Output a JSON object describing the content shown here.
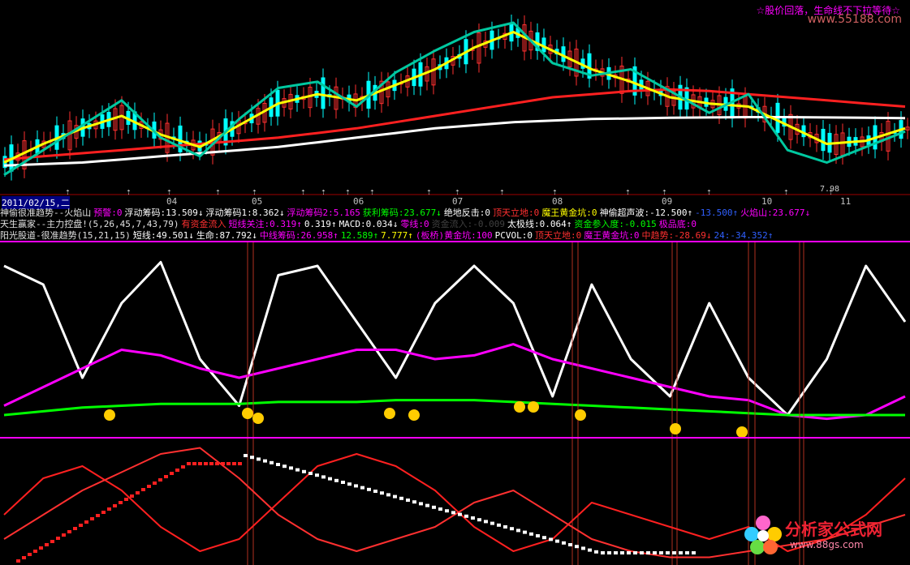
{
  "header": {
    "badge": "☆股价回落，生命线不下拉等待☆",
    "watermark": "www.55188.com"
  },
  "dates": [
    {
      "label": "2011/02/15,二",
      "slot": 0
    },
    {
      "label": "04",
      "slot": 1
    },
    {
      "label": "05",
      "slot": 2
    },
    {
      "label": "06",
      "slot": 3
    },
    {
      "label": "07",
      "slot": 4
    },
    {
      "label": "08",
      "slot": 5
    },
    {
      "label": "09",
      "slot": 6
    },
    {
      "label": "10",
      "slot": 7
    },
    {
      "label": "11",
      "slot": 8
    }
  ],
  "price_note": "7.98",
  "info_rows": [
    {
      "items": [
        {
          "text": "神偷很准趋势--火焰山",
          "color": "#e0e0e0"
        },
        {
          "text": "预警:0",
          "color": "#ff00ff"
        },
        {
          "text": "浮动筹码:13.509↓",
          "color": "#ffffff"
        },
        {
          "text": "浮动筹码1:8.362↓",
          "color": "#ffffff"
        },
        {
          "text": "浮动筹码2:5.165",
          "color": "#ff00ff"
        },
        {
          "text": "获利筹码:23.677↓",
          "color": "#00ff00"
        },
        {
          "text": "绝地反击:0",
          "color": "#ffffff"
        },
        {
          "text": "顶天立地:0",
          "color": "#ff3030"
        },
        {
          "text": "魔王黄金坑:0",
          "color": "#ffff00"
        },
        {
          "text": "神偷超声波:-12.500↑",
          "color": "#ffffff"
        },
        {
          "text": "-13.500↑",
          "color": "#3060ff"
        },
        {
          "text": "火焰山:23.677↓",
          "color": "#ff00ff"
        }
      ]
    },
    {
      "items": [
        {
          "text": "天生赢家--主力控盘!(5,26,45,7,43,79)",
          "color": "#e0e0e0"
        },
        {
          "text": "有资金流入",
          "color": "#ff3030"
        },
        {
          "text": "短线关注:0.319↑",
          "color": "#ff00ff"
        },
        {
          "text": "0.319↑",
          "color": "#ffffff"
        },
        {
          "text": "MACD:0.034↓",
          "color": "#ffffff"
        },
        {
          "text": "零线:0",
          "color": "#ff00ff"
        },
        {
          "text": "资金流入:-0.009",
          "color": "#404040"
        },
        {
          "text": "太极线:0.064↑",
          "color": "#ffffff"
        },
        {
          "text": "资金参入度:-0.015",
          "color": "#00ff00"
        },
        {
          "text": "极品底:0",
          "color": "#ff00ff"
        }
      ]
    },
    {
      "items": [
        {
          "text": "阳光股道-很准趋势(15,21,15)",
          "color": "#e0e0e0"
        },
        {
          "text": "短线:49.501↓",
          "color": "#ffffff"
        },
        {
          "text": "生命:87.792↓",
          "color": "#ffffff"
        },
        {
          "text": "中线筹码:26.958↑",
          "color": "#ff00ff"
        },
        {
          "text": "12.589↑",
          "color": "#00ff00"
        },
        {
          "text": "7.777↑",
          "color": "#ffff00"
        },
        {
          "text": "(板桥)黄金坑:100",
          "color": "#ff00ff"
        },
        {
          "text": "PCVOL:0",
          "color": "#ffffff"
        },
        {
          "text": "顶天立地:0",
          "color": "#ff3030"
        },
        {
          "text": "魔王黄金坑:0",
          "color": "#ff00ff"
        },
        {
          "text": "中趋势:-28.69↓",
          "color": "#ff3030"
        },
        {
          "text": "24:-34.352↑",
          "color": "#3060ff"
        }
      ]
    }
  ],
  "logo": {
    "title": "分析家公式网",
    "url": "www.88gs.com"
  },
  "colors": {
    "up": "#ff3030",
    "down": "#00ffff",
    "ma_red": "#ff2020",
    "ma_white": "#ffffff",
    "yellow": "#ffff00",
    "magenta": "#ff00ff",
    "cyan_green": "#00c8a0",
    "green": "#00ff00"
  },
  "chart_data": {
    "type": "line",
    "panels": [
      {
        "name": "price",
        "series": [
          {
            "color": "#ff2020",
            "values": [
              6.5,
              6.6,
              6.7,
              6.8,
              6.9,
              7.0,
              7.1,
              7.2,
              7.35,
              7.5,
              7.7,
              7.9,
              8.1,
              8.3,
              8.5,
              8.6,
              8.7,
              8.75,
              8.7,
              8.6,
              8.5,
              8.4,
              8.3,
              8.2
            ]
          },
          {
            "color": "#ffffff",
            "values": [
              6.3,
              6.35,
              6.4,
              6.5,
              6.6,
              6.7,
              6.8,
              6.9,
              7.05,
              7.2,
              7.35,
              7.5,
              7.6,
              7.7,
              7.75,
              7.8,
              7.82,
              7.84,
              7.85,
              7.86,
              7.86,
              7.85,
              7.84,
              7.83
            ]
          },
          {
            "color": "#ffff00",
            "values": [
              6.4,
              7.0,
              7.5,
              7.9,
              7.3,
              6.9,
              7.6,
              8.3,
              8.6,
              8.4,
              8.9,
              9.4,
              10.1,
              10.6,
              10.0,
              9.4,
              9.0,
              8.5,
              8.3,
              8.2,
              7.6,
              7.0,
              7.1,
              7.5
            ]
          },
          {
            "color": "#00c8a0",
            "values": [
              6.0,
              6.8,
              7.6,
              8.4,
              7.2,
              6.6,
              7.8,
              8.8,
              9.0,
              8.2,
              9.3,
              10.0,
              10.6,
              10.9,
              9.6,
              9.2,
              9.4,
              8.7,
              8.0,
              8.6,
              6.8,
              6.4,
              6.9,
              7.4
            ]
          }
        ]
      },
      {
        "name": "trend",
        "series": [
          {
            "color": "#ffffff",
            "values": [
              90,
              80,
              30,
              70,
              92,
              40,
              15,
              85,
              90,
              60,
              30,
              70,
              90,
              70,
              20,
              80,
              40,
              20,
              70,
              30,
              10,
              40,
              90,
              60
            ]
          },
          {
            "color": "#ff00ff",
            "values": [
              15,
              25,
              35,
              45,
              42,
              35,
              30,
              35,
              40,
              45,
              45,
              40,
              42,
              48,
              40,
              35,
              30,
              25,
              20,
              18,
              10,
              8,
              10,
              20
            ]
          },
          {
            "color": "#00ff00",
            "values": [
              10,
              12,
              14,
              15,
              16,
              16,
              16,
              17,
              17,
              17,
              18,
              18,
              18,
              17,
              16,
              15,
              14,
              13,
              12,
              11,
              10,
              10,
              10,
              10
            ]
          }
        ]
      },
      {
        "name": "oscillator",
        "series": [
          {
            "color": "#ff2020",
            "values": [
              40,
              70,
              80,
              60,
              30,
              10,
              20,
              50,
              80,
              90,
              80,
              60,
              30,
              10,
              20,
              50,
              40,
              30,
              20,
              30,
              10,
              20,
              40,
              70
            ]
          },
          {
            "color": "#ff3030",
            "values": [
              20,
              40,
              60,
              75,
              90,
              95,
              70,
              40,
              20,
              10,
              20,
              30,
              50,
              60,
              40,
              20,
              10,
              5,
              5,
              10,
              15,
              20,
              30,
              40
            ]
          }
        ]
      }
    ]
  }
}
